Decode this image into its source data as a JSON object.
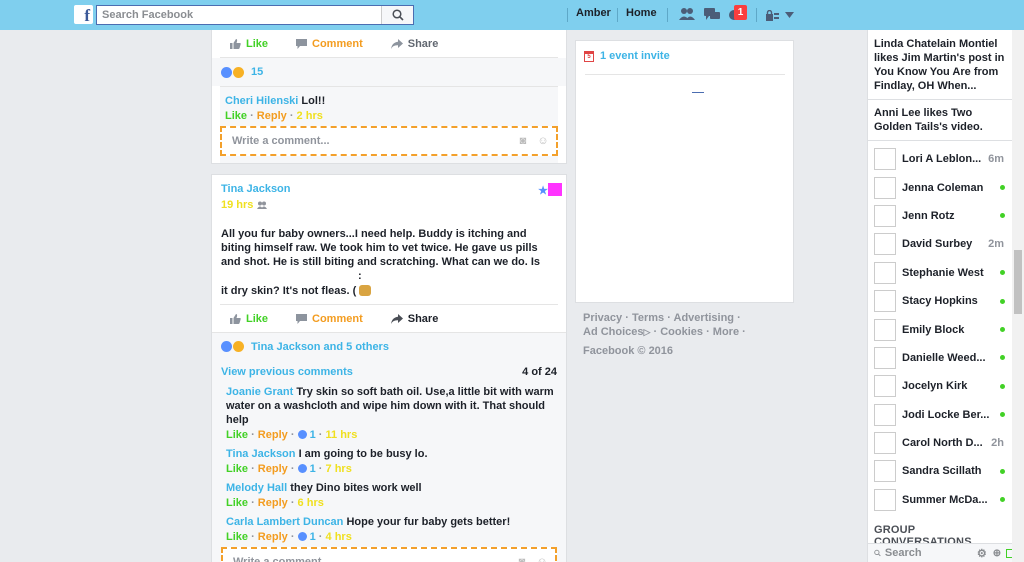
{
  "topbar": {
    "logo_glyph": "f",
    "search_placeholder": "Search Facebook",
    "user_name": "Amber",
    "home_label": "Home",
    "notification_count": "1"
  },
  "post1": {
    "actions": {
      "like": "Like",
      "comment": "Comment",
      "share": "Share"
    },
    "reaction_count": "15",
    "comments": [
      {
        "author": "Cheri Hilenski",
        "text": "Lol!!",
        "like": "Like",
        "reply": "Reply",
        "time": "2 hrs"
      }
    ],
    "write_placeholder": "Write a comment..."
  },
  "post2": {
    "author": "Tina Jackson",
    "time": "19 hrs",
    "body_lines": [
      "All you fur baby owners...I need help. Buddy is itching and",
      "biting himself raw. We took him to vet twice. He gave us pills",
      "and shot. He is still biting and scratching. What can we do. Is",
      ":",
      "it dry skin? It's not fleas. ("
    ],
    "actions": {
      "like": "Like",
      "comment": "Comment",
      "share": "Share"
    },
    "reactions_text": "Tina Jackson and 5 others",
    "view_previous": "View previous comments",
    "comment_count": "4 of 24",
    "comments": [
      {
        "author": "Joanie Grant",
        "text": "Try skin so soft bath oil. Use,a little bit with warm water on a washcloth and wipe him down with it. That should help",
        "like": "Like",
        "reply": "Reply",
        "likes": "1",
        "time": "11 hrs"
      },
      {
        "author": "Tina Jackson",
        "text": "I am going to be busy lo.",
        "like": "Like",
        "reply": "Reply",
        "likes": "1",
        "time": "7 hrs"
      },
      {
        "author": "Melody Hall",
        "text": "they Dino bites work well",
        "like": "Like",
        "reply": "Reply",
        "likes": "",
        "time": "6 hrs"
      },
      {
        "author": "Carla Lambert Duncan",
        "text": "Hope your fur baby gets better!",
        "like": "Like",
        "reply": "Reply",
        "likes": "1",
        "time": "4 hrs"
      }
    ],
    "write_placeholder": "Write a comment..."
  },
  "events": {
    "invite_text": "1 event invite",
    "calendar_digit": "5"
  },
  "footer": {
    "privacy": "Privacy",
    "terms": "Terms",
    "advertising": "Advertising",
    "ad_choices": "Ad Choices",
    "cookies": "Cookies",
    "more": "More",
    "copyright": "Facebook © 2016"
  },
  "ticker": [
    "Linda Chatelain Montiel likes Jim Martin's post in You Know You Are from Findlay, OH When...",
    "Anni Lee likes Two Golden Tails's video."
  ],
  "contacts": [
    {
      "name": "Lori A Leblon...",
      "status": "6m"
    },
    {
      "name": "Jenna Coleman",
      "status": "online"
    },
    {
      "name": "Jenn Rotz",
      "status": "online"
    },
    {
      "name": "David Surbey",
      "status": "2m"
    },
    {
      "name": "Stephanie West",
      "status": "online"
    },
    {
      "name": "Stacy Hopkins",
      "status": "online"
    },
    {
      "name": "Emily Block",
      "status": "online"
    },
    {
      "name": "Danielle Weed...",
      "status": "online"
    },
    {
      "name": "Jocelyn Kirk",
      "status": "online"
    },
    {
      "name": "Jodi Locke Ber...",
      "status": "online"
    },
    {
      "name": "Carol North D...",
      "status": "2h"
    },
    {
      "name": "Sandra Scillath",
      "status": "online"
    },
    {
      "name": "Summer McDa...",
      "status": "online"
    }
  ],
  "group_conversations_title": "GROUP CONVERSATIONS",
  "sidebar_search_placeholder": "Search",
  "colors": {
    "topbar": "#7fcfee",
    "link_blue": "#3db4e6",
    "like_green": "#42d126",
    "comment_orange": "#f39c1f",
    "time_yellow": "#f0e020",
    "badge_red": "#fa3e3e"
  }
}
